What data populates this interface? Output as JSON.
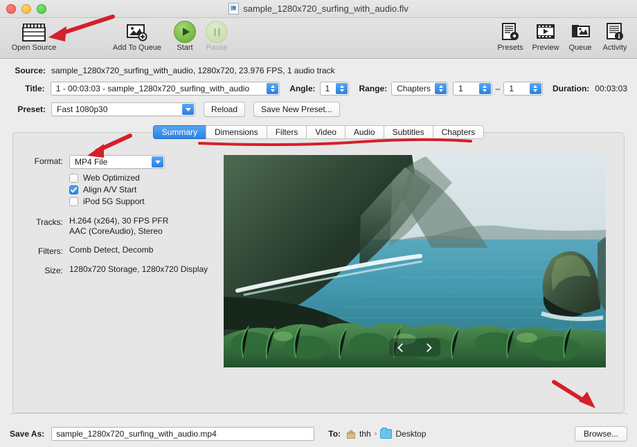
{
  "window": {
    "title": "sample_1280x720_surfing_with_audio.flv",
    "doc_icon": "video-file-icon",
    "controls": {
      "close": "close-button",
      "minimize": "minimize-button",
      "maximize": "maximize-button"
    }
  },
  "toolbar": {
    "items": [
      {
        "label": "Open Source",
        "icon": "clapperboard-icon"
      },
      {
        "label": "Add To Queue",
        "icon": "add-to-queue-icon"
      },
      {
        "label": "Start",
        "icon": "play-icon"
      },
      {
        "label": "Pause",
        "icon": "pause-icon"
      },
      {
        "label": "Presets",
        "icon": "presets-icon"
      },
      {
        "label": "Preview",
        "icon": "preview-film-icon"
      },
      {
        "label": "Queue",
        "icon": "queue-stack-icon"
      },
      {
        "label": "Activity",
        "icon": "activity-log-icon"
      }
    ]
  },
  "source": {
    "label": "Source:",
    "value": "sample_1280x720_surfing_with_audio, 1280x720, 23.976 FPS, 1 audio track"
  },
  "title_row": {
    "label": "Title:",
    "value": "1 - 00:03:03 - sample_1280x720_surfing_with_audio",
    "angle_label": "Angle:",
    "angle_value": "1",
    "range_label": "Range:",
    "range_type": "Chapters",
    "range_start": "1",
    "range_dash": "–",
    "range_end": "1",
    "duration_label": "Duration:",
    "duration_value": "00:03:03"
  },
  "preset_row": {
    "label": "Preset:",
    "value": "Fast 1080p30",
    "reload_label": "Reload",
    "save_label": "Save New Preset..."
  },
  "tabs": [
    {
      "label": "Summary",
      "active": true
    },
    {
      "label": "Dimensions",
      "active": false
    },
    {
      "label": "Filters",
      "active": false
    },
    {
      "label": "Video",
      "active": false
    },
    {
      "label": "Audio",
      "active": false
    },
    {
      "label": "Subtitles",
      "active": false
    },
    {
      "label": "Chapters",
      "active": false
    }
  ],
  "summary": {
    "format_label": "Format:",
    "format_value": "MP4 File",
    "checkboxes": [
      {
        "label": "Web Optimized",
        "checked": false
      },
      {
        "label": "Align A/V Start",
        "checked": true
      },
      {
        "label": "iPod 5G Support",
        "checked": false
      }
    ],
    "tracks_label": "Tracks:",
    "tracks_line1": "H.264 (x264), 30 FPS PFR",
    "tracks_line2": "AAC (CoreAudio), Stereo",
    "filters_label": "Filters:",
    "filters_value": "Comb Detect, Decomb",
    "size_label": "Size:",
    "size_value": "1280x720 Storage, 1280x720 Display",
    "preview": {
      "name": "video-preview-image",
      "description": "Coastal cliffs with sea stack, turquoise ocean and green foliage",
      "prev_icon": "chevron-left-icon",
      "next_icon": "chevron-right-icon"
    }
  },
  "bottom": {
    "save_as_label": "Save As:",
    "save_as_value": "sample_1280x720_surfing_with_audio.mp4",
    "to_label": "To:",
    "path_home": "thh",
    "path_sep": "›",
    "path_folder": "Desktop",
    "browse_label": "Browse..."
  },
  "annotations": {
    "color": "#d4202a",
    "arrows": [
      {
        "name": "arrow-to-open-source",
        "target": "Open Source"
      },
      {
        "name": "arrow-to-format",
        "target": "Format"
      },
      {
        "name": "arrow-to-browse",
        "target": "Browse..."
      }
    ],
    "underline": {
      "name": "tabs-underline",
      "target": "tab bar"
    }
  },
  "colors": {
    "accent_blue": "#2d82e4",
    "window_bg": "#ececec",
    "panel_bg": "#e6e6e6",
    "annotation_red": "#d4202a",
    "start_green": "#74b843"
  }
}
